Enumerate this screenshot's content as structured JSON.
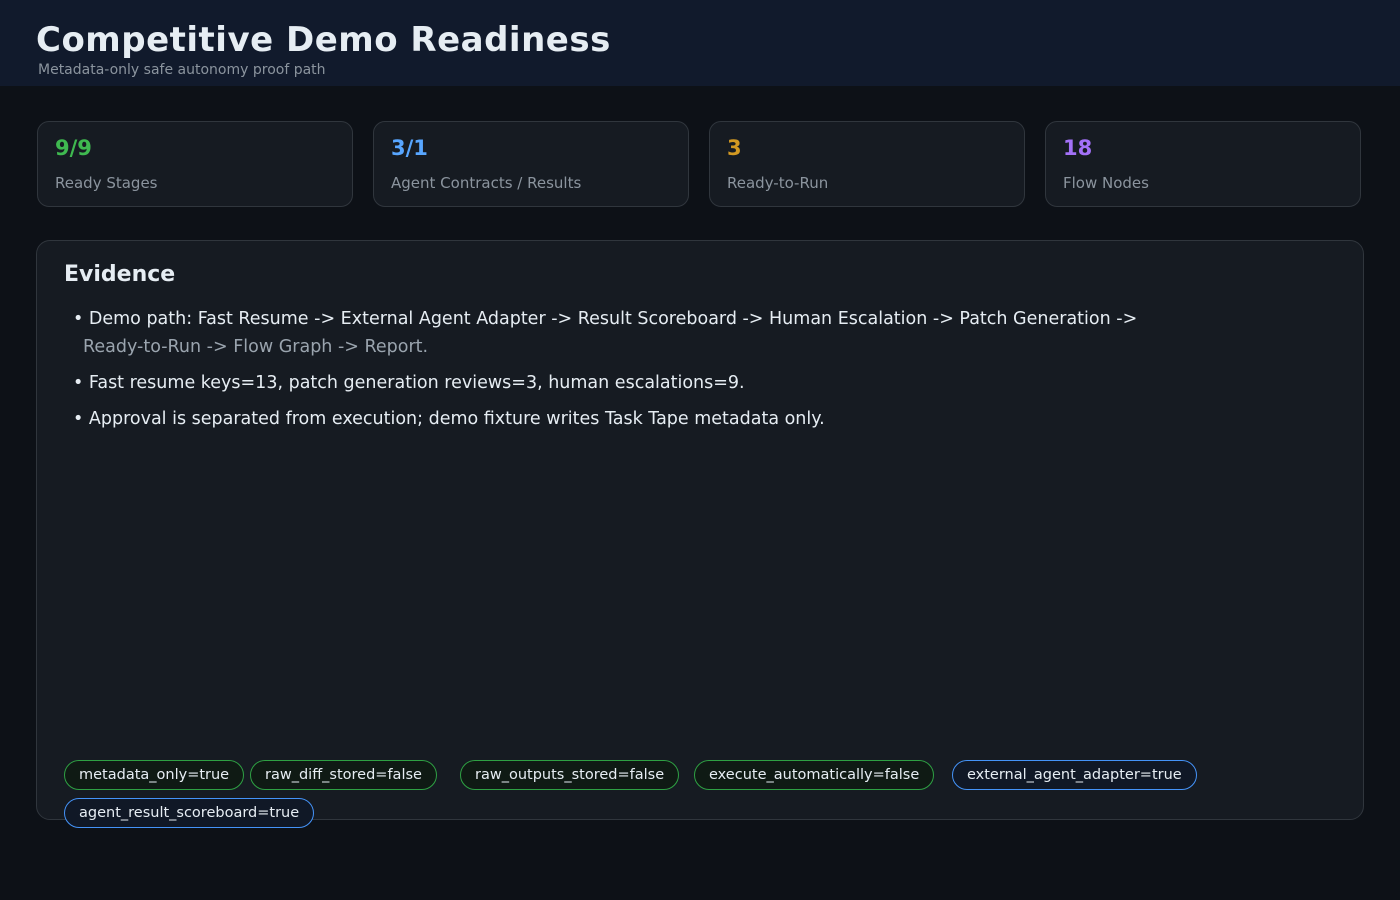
{
  "header": {
    "title": "Competitive Demo Readiness",
    "subtitle": "Metadata-only safe autonomy proof path"
  },
  "stats": [
    {
      "value": "9/9",
      "label": "Ready Stages",
      "color": "#3fb950"
    },
    {
      "value": "3/1",
      "label": "Agent Contracts / Results",
      "color": "#58a6ff"
    },
    {
      "value": "3",
      "label": "Ready-to-Run",
      "color": "#d29922"
    },
    {
      "value": "18",
      "label": "Flow Nodes",
      "color": "#a371f7"
    }
  ],
  "evidence": {
    "title": "Evidence",
    "bullets": [
      "• Demo path: Fast Resume -> External Agent Adapter -> Result Scoreboard -> Human Escalation -> Patch Generation ->",
      "Ready-to-Run -> Flow Graph -> Report.",
      "• Fast resume keys=13, patch generation reviews=3, human escalations=9.",
      "• Approval is separated from execution; demo fixture writes Task Tape metadata only."
    ],
    "flags": [
      {
        "label": "metadata_only=true",
        "color": "#2ea043"
      },
      {
        "label": "raw_diff_stored=false",
        "color": "#2ea043"
      },
      {
        "label": "raw_outputs_stored=false",
        "color": "#2ea043"
      },
      {
        "label": "execute_automatically=false",
        "color": "#2ea043"
      },
      {
        "label": "external_agent_adapter=true",
        "color": "#4493f8"
      },
      {
        "label": "agent_result_scoreboard=true",
        "color": "#4493f8"
      }
    ]
  }
}
